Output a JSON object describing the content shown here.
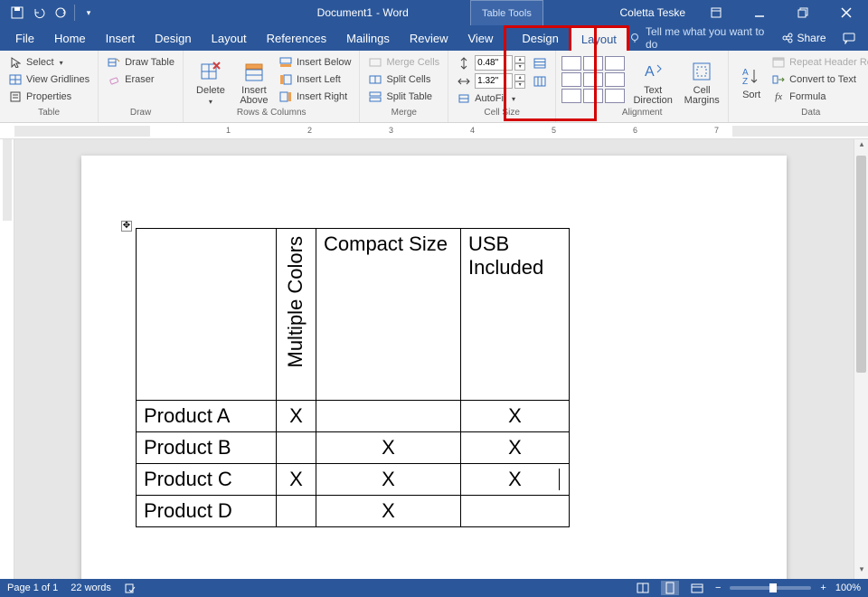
{
  "app": {
    "doc_name": "Document1",
    "app_suffix": " - Word",
    "tool_context": "Table Tools",
    "account": "Coletta Teske"
  },
  "tabs": {
    "file": "File",
    "home": "Home",
    "insert": "Insert",
    "design": "Design",
    "layout": "Layout",
    "references": "References",
    "mailings": "Mailings",
    "review": "Review",
    "view": "View",
    "table_design": "Design",
    "table_layout": "Layout",
    "tell_me": "Tell me what you want to do",
    "share": "Share"
  },
  "ribbon": {
    "table": {
      "label": "Table",
      "select": "Select",
      "view_gridlines": "View Gridlines",
      "properties": "Properties"
    },
    "draw": {
      "label": "Draw",
      "draw_table": "Draw Table",
      "eraser": "Eraser"
    },
    "rowscols": {
      "label": "Rows & Columns",
      "delete": "Delete",
      "insert_above": "Insert\nAbove",
      "insert_below": "Insert Below",
      "insert_left": "Insert Left",
      "insert_right": "Insert Right"
    },
    "merge": {
      "label": "Merge",
      "merge_cells": "Merge Cells",
      "split_cells": "Split Cells",
      "split_table": "Split Table"
    },
    "cellsize": {
      "label": "Cell Size",
      "height": "0.48\"",
      "width": "1.32\"",
      "autofit": "AutoFit"
    },
    "alignment": {
      "label": "Alignment",
      "text_direction": "Text\nDirection",
      "cell_margins": "Cell\nMargins"
    },
    "sort_group": {
      "label": "Data",
      "sort": "Sort",
      "repeat_header": "Repeat Header Rows",
      "convert": "Convert to Text",
      "formula": "Formula"
    }
  },
  "ruler": {
    "nums": [
      "1",
      "2",
      "3",
      "4",
      "5",
      "6",
      "7"
    ]
  },
  "content_table": {
    "headers": [
      "",
      "Multiple Colors",
      "Compact Size",
      "USB Included"
    ],
    "rows": [
      {
        "label": "Product A",
        "c1": "X",
        "c2": "",
        "c3": "X"
      },
      {
        "label": "Product B",
        "c1": "",
        "c2": "X",
        "c3": "X"
      },
      {
        "label": "Product C",
        "c1": "X",
        "c2": "X",
        "c3": "X"
      },
      {
        "label": "Product D",
        "c1": "",
        "c2": "X",
        "c3": ""
      }
    ]
  },
  "status": {
    "page": "Page 1 of 1",
    "words": "22 words",
    "zoom": "100%",
    "zoom_minus": "−",
    "zoom_plus": "+"
  }
}
